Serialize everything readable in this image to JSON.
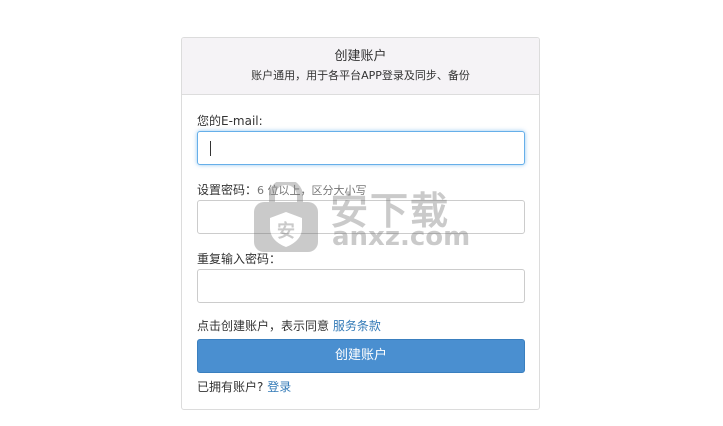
{
  "header": {
    "title": "创建账户",
    "subtitle": "账户通用，用于各平台APP登录及同步、备份"
  },
  "form": {
    "email_label": "您的E-mail:",
    "email_value": "",
    "password_label": "设置密码：",
    "password_hint": "6 位以上，区分大小写",
    "password_value": "",
    "confirm_label": "重复输入密码：",
    "confirm_value": ""
  },
  "terms": {
    "text": "点击创建账户，表示同意 ",
    "link_label": "服务条款"
  },
  "submit_label": "创建账户",
  "login": {
    "text": "已拥有账户? ",
    "link_label": "登录"
  },
  "watermark": {
    "icon": "shield-lock-icon",
    "text_top": "安下载",
    "text_bottom": "anxz.com"
  },
  "colors": {
    "accent": "#4a8fd0",
    "link": "#337ab7",
    "header_bg": "#f5f3f6",
    "focus_border": "#66afe9"
  }
}
